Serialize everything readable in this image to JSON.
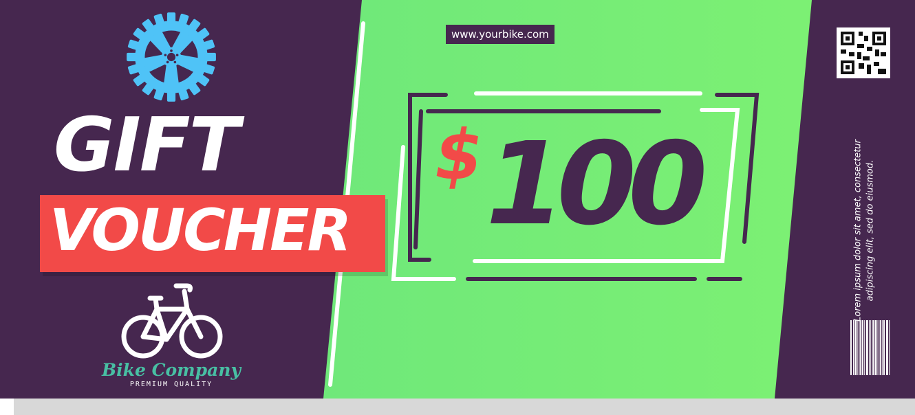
{
  "brand": {
    "name": "Bike Company",
    "tagline": "PREMIUM QUALITY",
    "website": "www.yourbike.com"
  },
  "voucher": {
    "title_line1": "GIFT",
    "title_line2": "VOUCHER",
    "currency": "$",
    "amount": "100",
    "description": "Lorem ipsum dolor sit amet, consectetur adipiscing elit, sed do eiusmod."
  },
  "icons": {
    "gear": "bicycle-chainring-icon",
    "bike": "bicycle-icon",
    "qr": "qr-code-icon",
    "barcode": "barcode-icon"
  },
  "colors": {
    "purple": "#46274f",
    "green": "#7ff272",
    "red": "#f24a48",
    "gear_blue": "#4fc3f7",
    "teal": "#48bfa3",
    "white": "#ffffff"
  }
}
